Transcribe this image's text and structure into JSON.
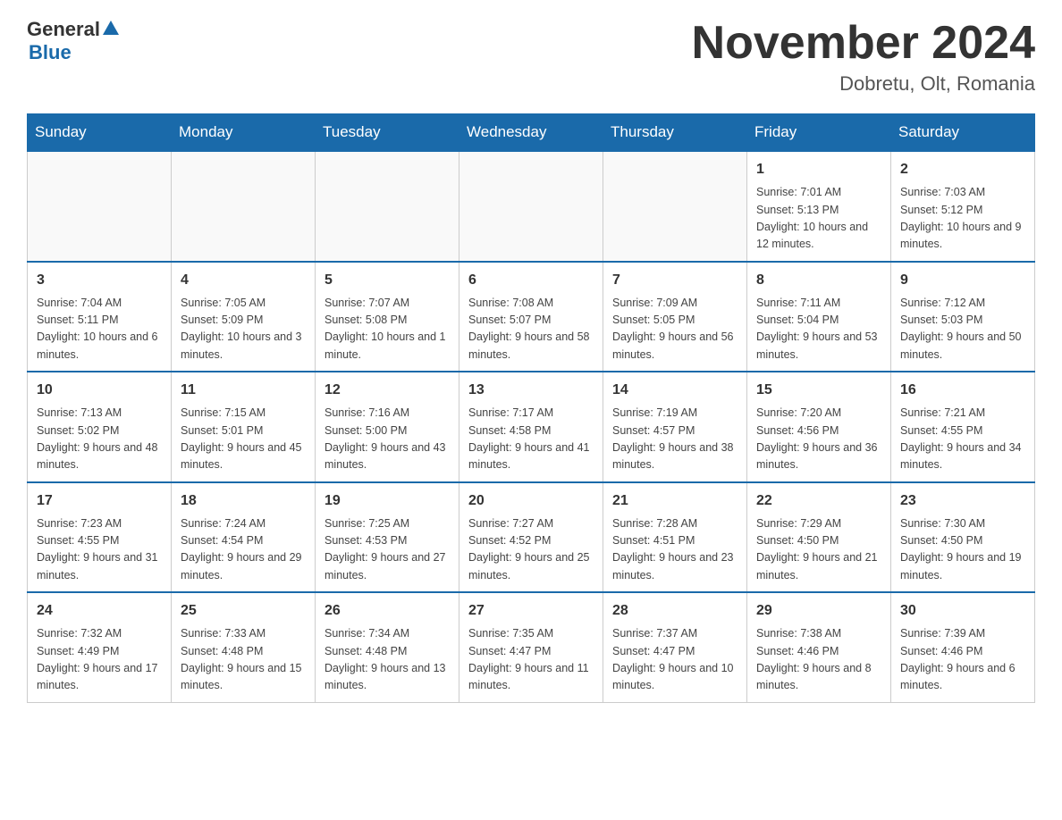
{
  "header": {
    "logo_general": "General",
    "logo_blue": "Blue",
    "title": "November 2024",
    "location": "Dobretu, Olt, Romania"
  },
  "days_of_week": [
    "Sunday",
    "Monday",
    "Tuesday",
    "Wednesday",
    "Thursday",
    "Friday",
    "Saturday"
  ],
  "weeks": [
    {
      "days": [
        {
          "num": "",
          "sunrise": "",
          "sunset": "",
          "daylight": ""
        },
        {
          "num": "",
          "sunrise": "",
          "sunset": "",
          "daylight": ""
        },
        {
          "num": "",
          "sunrise": "",
          "sunset": "",
          "daylight": ""
        },
        {
          "num": "",
          "sunrise": "",
          "sunset": "",
          "daylight": ""
        },
        {
          "num": "",
          "sunrise": "",
          "sunset": "",
          "daylight": ""
        },
        {
          "num": "1",
          "sunrise": "Sunrise: 7:01 AM",
          "sunset": "Sunset: 5:13 PM",
          "daylight": "Daylight: 10 hours and 12 minutes."
        },
        {
          "num": "2",
          "sunrise": "Sunrise: 7:03 AM",
          "sunset": "Sunset: 5:12 PM",
          "daylight": "Daylight: 10 hours and 9 minutes."
        }
      ]
    },
    {
      "days": [
        {
          "num": "3",
          "sunrise": "Sunrise: 7:04 AM",
          "sunset": "Sunset: 5:11 PM",
          "daylight": "Daylight: 10 hours and 6 minutes."
        },
        {
          "num": "4",
          "sunrise": "Sunrise: 7:05 AM",
          "sunset": "Sunset: 5:09 PM",
          "daylight": "Daylight: 10 hours and 3 minutes."
        },
        {
          "num": "5",
          "sunrise": "Sunrise: 7:07 AM",
          "sunset": "Sunset: 5:08 PM",
          "daylight": "Daylight: 10 hours and 1 minute."
        },
        {
          "num": "6",
          "sunrise": "Sunrise: 7:08 AM",
          "sunset": "Sunset: 5:07 PM",
          "daylight": "Daylight: 9 hours and 58 minutes."
        },
        {
          "num": "7",
          "sunrise": "Sunrise: 7:09 AM",
          "sunset": "Sunset: 5:05 PM",
          "daylight": "Daylight: 9 hours and 56 minutes."
        },
        {
          "num": "8",
          "sunrise": "Sunrise: 7:11 AM",
          "sunset": "Sunset: 5:04 PM",
          "daylight": "Daylight: 9 hours and 53 minutes."
        },
        {
          "num": "9",
          "sunrise": "Sunrise: 7:12 AM",
          "sunset": "Sunset: 5:03 PM",
          "daylight": "Daylight: 9 hours and 50 minutes."
        }
      ]
    },
    {
      "days": [
        {
          "num": "10",
          "sunrise": "Sunrise: 7:13 AM",
          "sunset": "Sunset: 5:02 PM",
          "daylight": "Daylight: 9 hours and 48 minutes."
        },
        {
          "num": "11",
          "sunrise": "Sunrise: 7:15 AM",
          "sunset": "Sunset: 5:01 PM",
          "daylight": "Daylight: 9 hours and 45 minutes."
        },
        {
          "num": "12",
          "sunrise": "Sunrise: 7:16 AM",
          "sunset": "Sunset: 5:00 PM",
          "daylight": "Daylight: 9 hours and 43 minutes."
        },
        {
          "num": "13",
          "sunrise": "Sunrise: 7:17 AM",
          "sunset": "Sunset: 4:58 PM",
          "daylight": "Daylight: 9 hours and 41 minutes."
        },
        {
          "num": "14",
          "sunrise": "Sunrise: 7:19 AM",
          "sunset": "Sunset: 4:57 PM",
          "daylight": "Daylight: 9 hours and 38 minutes."
        },
        {
          "num": "15",
          "sunrise": "Sunrise: 7:20 AM",
          "sunset": "Sunset: 4:56 PM",
          "daylight": "Daylight: 9 hours and 36 minutes."
        },
        {
          "num": "16",
          "sunrise": "Sunrise: 7:21 AM",
          "sunset": "Sunset: 4:55 PM",
          "daylight": "Daylight: 9 hours and 34 minutes."
        }
      ]
    },
    {
      "days": [
        {
          "num": "17",
          "sunrise": "Sunrise: 7:23 AM",
          "sunset": "Sunset: 4:55 PM",
          "daylight": "Daylight: 9 hours and 31 minutes."
        },
        {
          "num": "18",
          "sunrise": "Sunrise: 7:24 AM",
          "sunset": "Sunset: 4:54 PM",
          "daylight": "Daylight: 9 hours and 29 minutes."
        },
        {
          "num": "19",
          "sunrise": "Sunrise: 7:25 AM",
          "sunset": "Sunset: 4:53 PM",
          "daylight": "Daylight: 9 hours and 27 minutes."
        },
        {
          "num": "20",
          "sunrise": "Sunrise: 7:27 AM",
          "sunset": "Sunset: 4:52 PM",
          "daylight": "Daylight: 9 hours and 25 minutes."
        },
        {
          "num": "21",
          "sunrise": "Sunrise: 7:28 AM",
          "sunset": "Sunset: 4:51 PM",
          "daylight": "Daylight: 9 hours and 23 minutes."
        },
        {
          "num": "22",
          "sunrise": "Sunrise: 7:29 AM",
          "sunset": "Sunset: 4:50 PM",
          "daylight": "Daylight: 9 hours and 21 minutes."
        },
        {
          "num": "23",
          "sunrise": "Sunrise: 7:30 AM",
          "sunset": "Sunset: 4:50 PM",
          "daylight": "Daylight: 9 hours and 19 minutes."
        }
      ]
    },
    {
      "days": [
        {
          "num": "24",
          "sunrise": "Sunrise: 7:32 AM",
          "sunset": "Sunset: 4:49 PM",
          "daylight": "Daylight: 9 hours and 17 minutes."
        },
        {
          "num": "25",
          "sunrise": "Sunrise: 7:33 AM",
          "sunset": "Sunset: 4:48 PM",
          "daylight": "Daylight: 9 hours and 15 minutes."
        },
        {
          "num": "26",
          "sunrise": "Sunrise: 7:34 AM",
          "sunset": "Sunset: 4:48 PM",
          "daylight": "Daylight: 9 hours and 13 minutes."
        },
        {
          "num": "27",
          "sunrise": "Sunrise: 7:35 AM",
          "sunset": "Sunset: 4:47 PM",
          "daylight": "Daylight: 9 hours and 11 minutes."
        },
        {
          "num": "28",
          "sunrise": "Sunrise: 7:37 AM",
          "sunset": "Sunset: 4:47 PM",
          "daylight": "Daylight: 9 hours and 10 minutes."
        },
        {
          "num": "29",
          "sunrise": "Sunrise: 7:38 AM",
          "sunset": "Sunset: 4:46 PM",
          "daylight": "Daylight: 9 hours and 8 minutes."
        },
        {
          "num": "30",
          "sunrise": "Sunrise: 7:39 AM",
          "sunset": "Sunset: 4:46 PM",
          "daylight": "Daylight: 9 hours and 6 minutes."
        }
      ]
    }
  ]
}
